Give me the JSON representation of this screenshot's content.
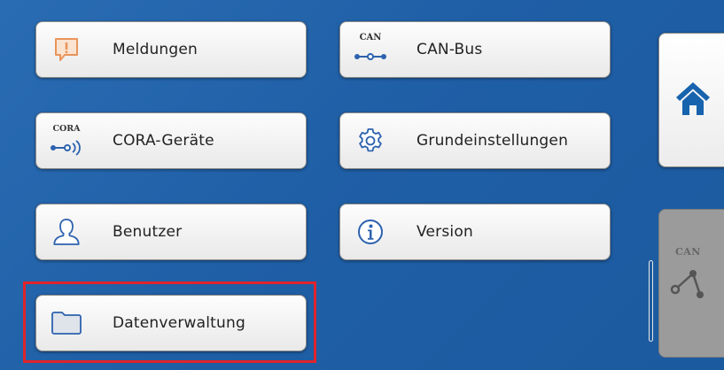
{
  "menu": {
    "meldungen": {
      "label": "Meldungen",
      "icon": "alert-message-icon"
    },
    "can_bus": {
      "label": "CAN-Bus",
      "icon_text": "CAN",
      "icon": "can-bus-icon"
    },
    "cora": {
      "label": "CORA-Geräte",
      "icon_text": "CORA",
      "icon": "cora-wireless-icon"
    },
    "grundeinstellungen": {
      "label": "Grundeinstellungen",
      "icon": "gear-icon"
    },
    "benutzer": {
      "label": "Benutzer",
      "icon": "user-icon"
    },
    "version": {
      "label": "Version",
      "icon": "info-icon"
    },
    "datenverwaltung": {
      "label": "Datenverwaltung",
      "icon": "folder-icon"
    }
  },
  "side": {
    "home_icon": "home-icon",
    "can_text": "CAN",
    "can_icon": "can-network-icon"
  },
  "colors": {
    "background": "#1f5fa6",
    "highlight": "#e0242b",
    "icon_orange": "#e8955a",
    "icon_blue": "#2d62ae",
    "home_blue": "#1763ad"
  }
}
